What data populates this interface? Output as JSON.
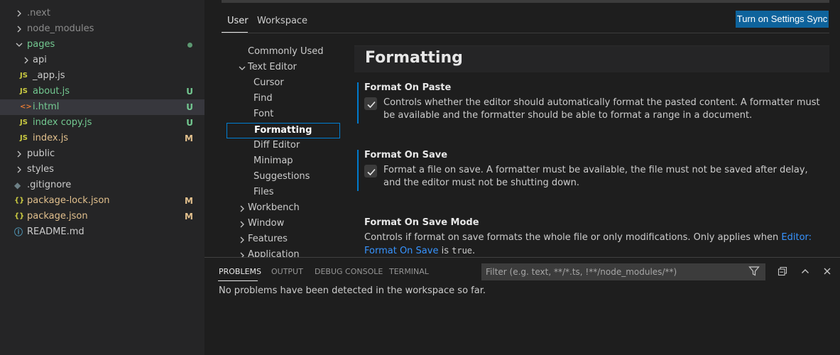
{
  "explorer": {
    "items": [
      {
        "name": ".next",
        "indent": 1,
        "chevron": "right",
        "icon": "",
        "icon_color": "",
        "color": "dim",
        "badge": ""
      },
      {
        "name": "node_modules",
        "indent": 1,
        "chevron": "right",
        "icon": "",
        "icon_color": "",
        "color": "dim",
        "badge": ""
      },
      {
        "name": "pages",
        "indent": 1,
        "chevron": "down",
        "icon": "",
        "icon_color": "",
        "color": "green",
        "badge": "dot"
      },
      {
        "name": "api",
        "indent": 2,
        "chevron": "right",
        "icon": "",
        "icon_color": "",
        "color": "normal",
        "badge": ""
      },
      {
        "name": "_app.js",
        "indent": 2,
        "chevron": "",
        "icon": "JS",
        "icon_color": "#cbcb41",
        "color": "normal",
        "badge": ""
      },
      {
        "name": "about.js",
        "indent": 2,
        "chevron": "",
        "icon": "JS",
        "icon_color": "#cbcb41",
        "color": "green",
        "badge": "U"
      },
      {
        "name": "i.html",
        "indent": 2,
        "chevron": "",
        "icon": "<>",
        "icon_color": "#e37933",
        "color": "green",
        "badge": "U",
        "selected": true
      },
      {
        "name": "index copy.js",
        "indent": 2,
        "chevron": "",
        "icon": "JS",
        "icon_color": "#cbcb41",
        "color": "green",
        "badge": "U"
      },
      {
        "name": "index.js",
        "indent": 2,
        "chevron": "",
        "icon": "JS",
        "icon_color": "#cbcb41",
        "color": "mod",
        "badge": "M"
      },
      {
        "name": "public",
        "indent": 1,
        "chevron": "right",
        "icon": "",
        "icon_color": "",
        "color": "normal",
        "badge": ""
      },
      {
        "name": "styles",
        "indent": 1,
        "chevron": "right",
        "icon": "",
        "icon_color": "",
        "color": "normal",
        "badge": ""
      },
      {
        "name": ".gitignore",
        "indent": 1,
        "chevron": "",
        "icon": "◆",
        "icon_color": "#6d8086",
        "color": "normal",
        "badge": ""
      },
      {
        "name": "package-lock.json",
        "indent": 1,
        "chevron": "",
        "icon": "{}",
        "icon_color": "#cbcb41",
        "color": "mod",
        "badge": "M"
      },
      {
        "name": "package.json",
        "indent": 1,
        "chevron": "",
        "icon": "{}",
        "icon_color": "#cbcb41",
        "color": "mod",
        "badge": "M"
      },
      {
        "name": "README.md",
        "indent": 1,
        "chevron": "",
        "icon": "ⓘ",
        "icon_color": "#519aba",
        "color": "normal",
        "badge": ""
      }
    ]
  },
  "settings": {
    "tabs": {
      "user": "User",
      "workspace": "Workspace"
    },
    "sync_button": "Turn on Settings Sync",
    "toc": [
      {
        "label": "Commonly Used",
        "level": 0,
        "chevron": ""
      },
      {
        "label": "Text Editor",
        "level": 0,
        "chevron": "down"
      },
      {
        "label": "Cursor",
        "level": 1,
        "chevron": ""
      },
      {
        "label": "Find",
        "level": 1,
        "chevron": ""
      },
      {
        "label": "Font",
        "level": 1,
        "chevron": ""
      },
      {
        "label": "Formatting",
        "level": 1,
        "chevron": "",
        "selected": true
      },
      {
        "label": "Diff Editor",
        "level": 1,
        "chevron": ""
      },
      {
        "label": "Minimap",
        "level": 1,
        "chevron": ""
      },
      {
        "label": "Suggestions",
        "level": 1,
        "chevron": ""
      },
      {
        "label": "Files",
        "level": 1,
        "chevron": ""
      },
      {
        "label": "Workbench",
        "level": 0,
        "chevron": "right"
      },
      {
        "label": "Window",
        "level": 0,
        "chevron": "right"
      },
      {
        "label": "Features",
        "level": 0,
        "chevron": "right"
      },
      {
        "label": "Application",
        "level": 0,
        "chevron": "right"
      }
    ],
    "section_title": "Formatting",
    "format_on_paste": {
      "title": "Format On Paste",
      "checked": true,
      "description": "Controls whether the editor should automatically format the pasted content. A formatter must be available and the formatter should be able to format a range in a document."
    },
    "format_on_save": {
      "title": "Format On Save",
      "checked": true,
      "description": "Format a file on save. A formatter must be available, the file must not be saved after delay, and the editor must not be shutting down."
    },
    "format_on_save_mode": {
      "title": "Format On Save Mode",
      "description_before": "Controls if format on save formats the whole file or only modifications. Only applies when ",
      "link": "Editor: Format On Save",
      "description_mid": " is ",
      "value": "true",
      "description_after": "."
    }
  },
  "panel": {
    "tabs": {
      "problems": "PROBLEMS",
      "output": "OUTPUT",
      "debug_console": "DEBUG CONSOLE",
      "terminal": "TERMINAL"
    },
    "filter_placeholder": "Filter (e.g. text, **/*.ts, !**/node_modules/**)",
    "message": "No problems have been detected in the workspace so far."
  },
  "colors": {
    "accent": "#007acc",
    "sync_button_bg": "#0e639c",
    "link": "#3794ff",
    "untracked": "#73c991",
    "modified": "#e2c08d"
  }
}
